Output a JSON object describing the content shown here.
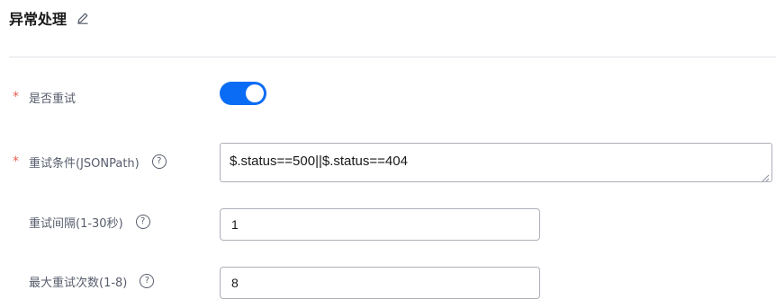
{
  "section": {
    "title": "异常处理"
  },
  "retry_enabled": {
    "label": "是否重试",
    "required_mark": "*",
    "checked": true,
    "accent_color": "#0a6cf5"
  },
  "retry_condition": {
    "label": "重试条件(JSONPath)",
    "required_mark": "*",
    "help": "?",
    "value": "$.status==500||$.status==404"
  },
  "retry_interval": {
    "label": "重试间隔(1-30秒)",
    "help": "?",
    "value": "1"
  },
  "max_retries": {
    "label": "最大重试次数(1-8)",
    "help": "?",
    "value": "8"
  },
  "icons": {
    "edit": "pencil-edit-icon",
    "help": "question-circle-icon"
  }
}
